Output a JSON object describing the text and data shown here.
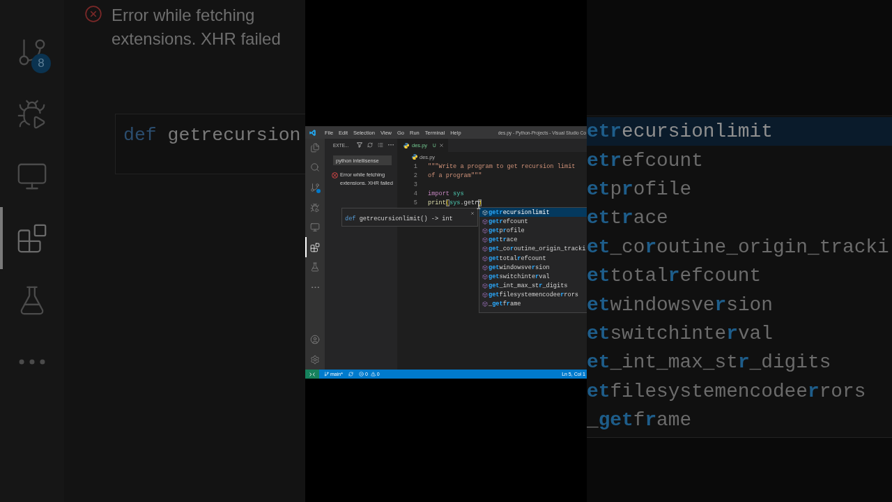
{
  "backdrop_left": {
    "activity_bar": [
      {
        "kind": "source-control",
        "selected": false,
        "badge": "8"
      },
      {
        "kind": "run-debug",
        "selected": false
      },
      {
        "kind": "remote",
        "selected": false
      },
      {
        "kind": "extensions",
        "selected": true
      },
      {
        "kind": "testing",
        "selected": false
      },
      {
        "kind": "more",
        "selected": false
      }
    ],
    "error": "Error while fetching extensions. XHR failed",
    "hover": [
      {
        "kind": "keyword",
        "text": "def"
      },
      {
        "kind": "plain",
        "text": " getrecursion"
      }
    ]
  },
  "window": {
    "title": "des.py - Python-Projects - Visual Studio Co",
    "menu": [
      "File",
      "Edit",
      "Selection",
      "View",
      "Go",
      "Run",
      "Terminal",
      "Help"
    ]
  },
  "activity_bar": {
    "top": [
      {
        "kind": "explorer",
        "selected": false,
        "badge_dot": false
      },
      {
        "kind": "search",
        "selected": false,
        "badge_dot": false
      },
      {
        "kind": "source-control",
        "selected": false,
        "badge_dot": true
      },
      {
        "kind": "run-debug",
        "selected": false,
        "badge_dot": false
      },
      {
        "kind": "remote",
        "selected": false,
        "badge_dot": false
      },
      {
        "kind": "extensions",
        "selected": true,
        "badge_dot": false
      },
      {
        "kind": "testing",
        "selected": false,
        "badge_dot": false
      },
      {
        "kind": "more",
        "selected": false,
        "badge_dot": false
      }
    ],
    "bottom": [
      {
        "kind": "account"
      },
      {
        "kind": "settings"
      }
    ]
  },
  "sidebar": {
    "title": "EXTE...",
    "search": {
      "value": "python intellisense"
    },
    "error": "Error while fetching extensions. XHR failed"
  },
  "editor": {
    "tabs": [
      {
        "label": "des.py",
        "status": "U",
        "untracked": true,
        "selected": true
      }
    ],
    "breadcrumb": "des.py",
    "lines": [
      {
        "number": "1",
        "tokens": [
          {
            "kind": "string",
            "text": "\"\"\"Write a program to get recursion limit"
          }
        ]
      },
      {
        "number": "2",
        "tokens": [
          {
            "kind": "string",
            "text": "of a program\"\"\""
          }
        ]
      },
      {
        "number": "3"
      },
      {
        "number": "4",
        "tokens": [
          {
            "kind": "control",
            "text": "import"
          },
          {
            "kind": "module",
            "text": " sys"
          }
        ]
      },
      {
        "number": "5",
        "tokens": [
          {
            "kind": "function",
            "text": "print"
          },
          {
            "kind": "bracket",
            "text": "("
          },
          {
            "kind": "module",
            "text": "sys"
          },
          {
            "kind": "plain",
            "text": ".getr"
          },
          {
            "kind": "bracket",
            "text": ")"
          }
        ]
      }
    ],
    "hover": [
      {
        "kind": "keyword",
        "text": "def"
      },
      {
        "kind": "plain",
        "text": " getrecursionlimit() -> int"
      }
    ],
    "suggestions": [
      {
        "selected": true,
        "parts": [
          {
            "text": "getr",
            "match": true
          },
          {
            "text": "ecursionlimit",
            "match": false
          }
        ]
      },
      {
        "selected": false,
        "parts": [
          {
            "text": "getr",
            "match": true
          },
          {
            "text": "efcount",
            "match": false
          }
        ]
      },
      {
        "selected": false,
        "parts": [
          {
            "text": "get",
            "match": true
          },
          {
            "text": "p",
            "match": false
          },
          {
            "text": "r",
            "match": true
          },
          {
            "text": "ofile",
            "match": false
          }
        ]
      },
      {
        "selected": false,
        "parts": [
          {
            "text": "get",
            "match": true
          },
          {
            "text": "t",
            "match": false
          },
          {
            "text": "r",
            "match": true
          },
          {
            "text": "ace",
            "match": false
          }
        ]
      },
      {
        "selected": false,
        "parts": [
          {
            "text": "get",
            "match": true
          },
          {
            "text": "_co",
            "match": false
          },
          {
            "text": "r",
            "match": true
          },
          {
            "text": "outine_origin_tracki",
            "match": false
          }
        ]
      },
      {
        "selected": false,
        "parts": [
          {
            "text": "get",
            "match": true
          },
          {
            "text": "total",
            "match": false
          },
          {
            "text": "r",
            "match": true
          },
          {
            "text": "efcount",
            "match": false
          }
        ]
      },
      {
        "selected": false,
        "parts": [
          {
            "text": "get",
            "match": true
          },
          {
            "text": "windowsve",
            "match": false
          },
          {
            "text": "r",
            "match": true
          },
          {
            "text": "sion",
            "match": false
          }
        ]
      },
      {
        "selected": false,
        "parts": [
          {
            "text": "get",
            "match": true
          },
          {
            "text": "switchinte",
            "match": false
          },
          {
            "text": "r",
            "match": true
          },
          {
            "text": "val",
            "match": false
          }
        ]
      },
      {
        "selected": false,
        "parts": [
          {
            "text": "get",
            "match": true
          },
          {
            "text": "_int_max_st",
            "match": false
          },
          {
            "text": "r",
            "match": true
          },
          {
            "text": "_digits",
            "match": false
          }
        ]
      },
      {
        "selected": false,
        "parts": [
          {
            "text": "get",
            "match": true
          },
          {
            "text": "filesystemencodee",
            "match": false
          },
          {
            "text": "r",
            "match": true
          },
          {
            "text": "rors",
            "match": false
          }
        ]
      },
      {
        "selected": false,
        "parts": [
          {
            "text": "_",
            "match": false
          },
          {
            "text": "get",
            "match": true
          },
          {
            "text": "f",
            "match": false
          },
          {
            "text": "r",
            "match": true
          },
          {
            "text": "ame",
            "match": false
          }
        ]
      }
    ]
  },
  "status_bar": {
    "branch": "main*",
    "errors": "0",
    "warnings": "0",
    "position": "Ln 5, Col 1"
  },
  "backdrop_right": {
    "suggestions": [
      {
        "selected": true,
        "parts": [
          {
            "text": "etr",
            "match": true
          },
          {
            "text": "ecursionlimit",
            "match": false
          }
        ]
      },
      {
        "selected": false,
        "parts": [
          {
            "text": "etr",
            "match": true
          },
          {
            "text": "efcount",
            "match": false
          }
        ]
      },
      {
        "selected": false,
        "parts": [
          {
            "text": "et",
            "match": true
          },
          {
            "text": "p",
            "match": false
          },
          {
            "text": "r",
            "match": true
          },
          {
            "text": "ofile",
            "match": false
          }
        ]
      },
      {
        "selected": false,
        "parts": [
          {
            "text": "et",
            "match": true
          },
          {
            "text": "t",
            "match": false
          },
          {
            "text": "r",
            "match": true
          },
          {
            "text": "ace",
            "match": false
          }
        ]
      },
      {
        "selected": false,
        "parts": [
          {
            "text": "et",
            "match": true
          },
          {
            "text": "_co",
            "match": false
          },
          {
            "text": "r",
            "match": true
          },
          {
            "text": "outine_origin_tracki",
            "match": false
          }
        ]
      },
      {
        "selected": false,
        "parts": [
          {
            "text": "et",
            "match": true
          },
          {
            "text": "total",
            "match": false
          },
          {
            "text": "r",
            "match": true
          },
          {
            "text": "efcount",
            "match": false
          }
        ]
      },
      {
        "selected": false,
        "parts": [
          {
            "text": "et",
            "match": true
          },
          {
            "text": "windowsve",
            "match": false
          },
          {
            "text": "r",
            "match": true
          },
          {
            "text": "sion",
            "match": false
          }
        ]
      },
      {
        "selected": false,
        "parts": [
          {
            "text": "et",
            "match": true
          },
          {
            "text": "switchinte",
            "match": false
          },
          {
            "text": "r",
            "match": true
          },
          {
            "text": "val",
            "match": false
          }
        ]
      },
      {
        "selected": false,
        "parts": [
          {
            "text": "et",
            "match": true
          },
          {
            "text": "_int_max_st",
            "match": false
          },
          {
            "text": "r",
            "match": true
          },
          {
            "text": "_digits",
            "match": false
          }
        ]
      },
      {
        "selected": false,
        "parts": [
          {
            "text": "et",
            "match": true
          },
          {
            "text": "filesystemencodee",
            "match": false
          },
          {
            "text": "r",
            "match": true
          },
          {
            "text": "rors",
            "match": false
          }
        ]
      },
      {
        "selected": false,
        "parts": [
          {
            "text": "_",
            "match": false
          },
          {
            "text": "get",
            "match": true
          },
          {
            "text": "f",
            "match": false
          },
          {
            "text": "r",
            "match": true
          },
          {
            "text": "ame",
            "match": false
          }
        ]
      }
    ]
  }
}
